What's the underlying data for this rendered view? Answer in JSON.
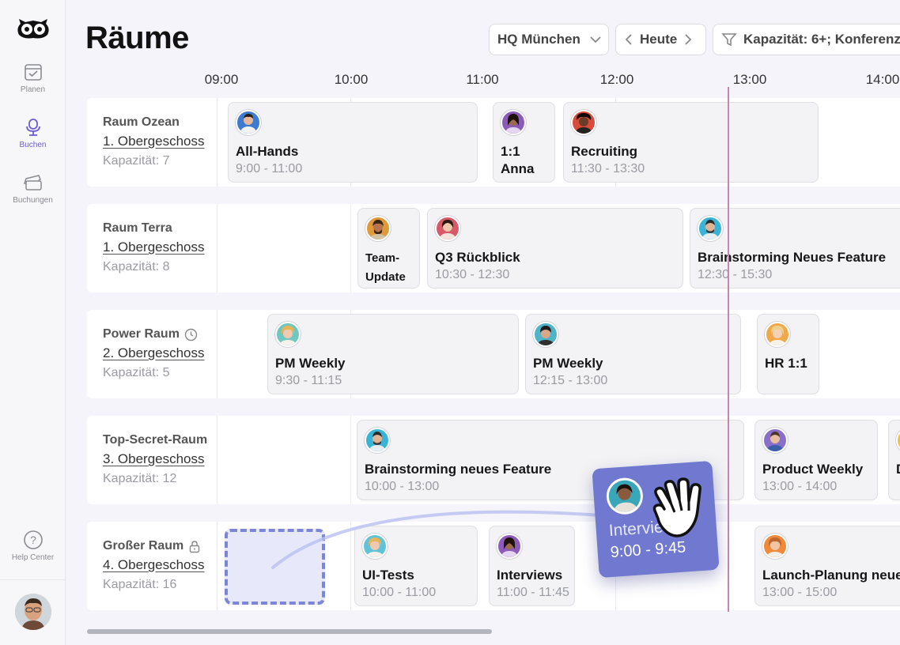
{
  "sidebar": {
    "nav": [
      {
        "label": "Planen",
        "icon": "calendar-check-icon",
        "active": false
      },
      {
        "label": "Buchen",
        "icon": "chair-icon",
        "active": true
      },
      {
        "label": "Buchungen",
        "icon": "ticket-icon",
        "active": false
      }
    ],
    "help_label": "Help Center"
  },
  "header": {
    "title": "Räume",
    "location": "HQ München",
    "today": "Heute",
    "filter": "Kapazität: 6+; Konferenz"
  },
  "timeline": {
    "hours": [
      "09:00",
      "10:00",
      "11:00",
      "12:00",
      "13:00",
      "14:00"
    ]
  },
  "rooms": [
    {
      "name": "Raum Ozean",
      "floor": "1. Obergeschoss",
      "capacity": "Kapazität: 7",
      "events": [
        {
          "title": "All-Hands",
          "time": "9:00 - 11:00",
          "avatar_color": "#3d7bd1"
        },
        {
          "title": "1:1 Anna",
          "time": "",
          "avatar_color": "#8a5bb8"
        },
        {
          "title": "Recruiting",
          "time": "11:30 - 13:30",
          "avatar_color": "#d94a3a"
        }
      ]
    },
    {
      "name": "Raum Terra",
      "floor": "1. Obergeschoss",
      "capacity": "Kapazität: 8",
      "events": [
        {
          "title": "Team-Update",
          "time": "",
          "avatar_color": "#e09a3a"
        },
        {
          "title": "Q3 Rückblick",
          "time": "10:30 - 12:30",
          "avatar_color": "#d65a6a"
        },
        {
          "title": "Brainstorming Neues Feature",
          "time": "12:30 - 15:30",
          "avatar_color": "#3ab4d6"
        }
      ]
    },
    {
      "name": "Power Raum",
      "floor": "2. Obergeschoss",
      "capacity": "Kapazität: 5",
      "events": [
        {
          "title": "PM Weekly",
          "time": "9:30 - 11:15",
          "avatar_color": "#6fc7c0"
        },
        {
          "title": "PM Weekly",
          "time": "12:15 - 13:00",
          "avatar_color": "#4fb3c9"
        },
        {
          "title": "HR 1:1",
          "time": "",
          "avatar_color": "#f0a94a"
        }
      ]
    },
    {
      "name": "Top-Secret-Raum",
      "floor": "3. Obergeschoss",
      "capacity": "Kapazität: 12",
      "events": [
        {
          "title": "Brainstorming neues Feature",
          "time": "10:00 - 13:00",
          "avatar_color": "#3ab4d6"
        },
        {
          "title": "Product Weekly",
          "time": "13:00 - 14:00",
          "avatar_color": "#8a6fc9"
        },
        {
          "title": "D",
          "time": "",
          "avatar_color": "#e8c34a"
        }
      ]
    },
    {
      "name": "Großer Raum",
      "floor": "4. Obergeschoss",
      "capacity": "Kapazität: 16",
      "events": [
        {
          "title": "UI-Tests",
          "time": "10:00 - 11:00",
          "avatar_color": "#5fc3d9"
        },
        {
          "title": "Interviews",
          "time": "11:00 - 11:45",
          "avatar_color": "#8e5bb8"
        },
        {
          "title": "Launch-Planung neue",
          "time": "13:00 - 15:00",
          "avatar_color": "#f08a3a"
        }
      ]
    }
  ],
  "drag": {
    "title": "Intervie",
    "time": "9:00 - 9:45",
    "avatar_color": "#3aa7b8"
  },
  "colors": {
    "accent": "#6b5bd6",
    "now_line": "#c985b2",
    "drag_card": "#7078cf",
    "drop_border": "#7b86d6"
  }
}
